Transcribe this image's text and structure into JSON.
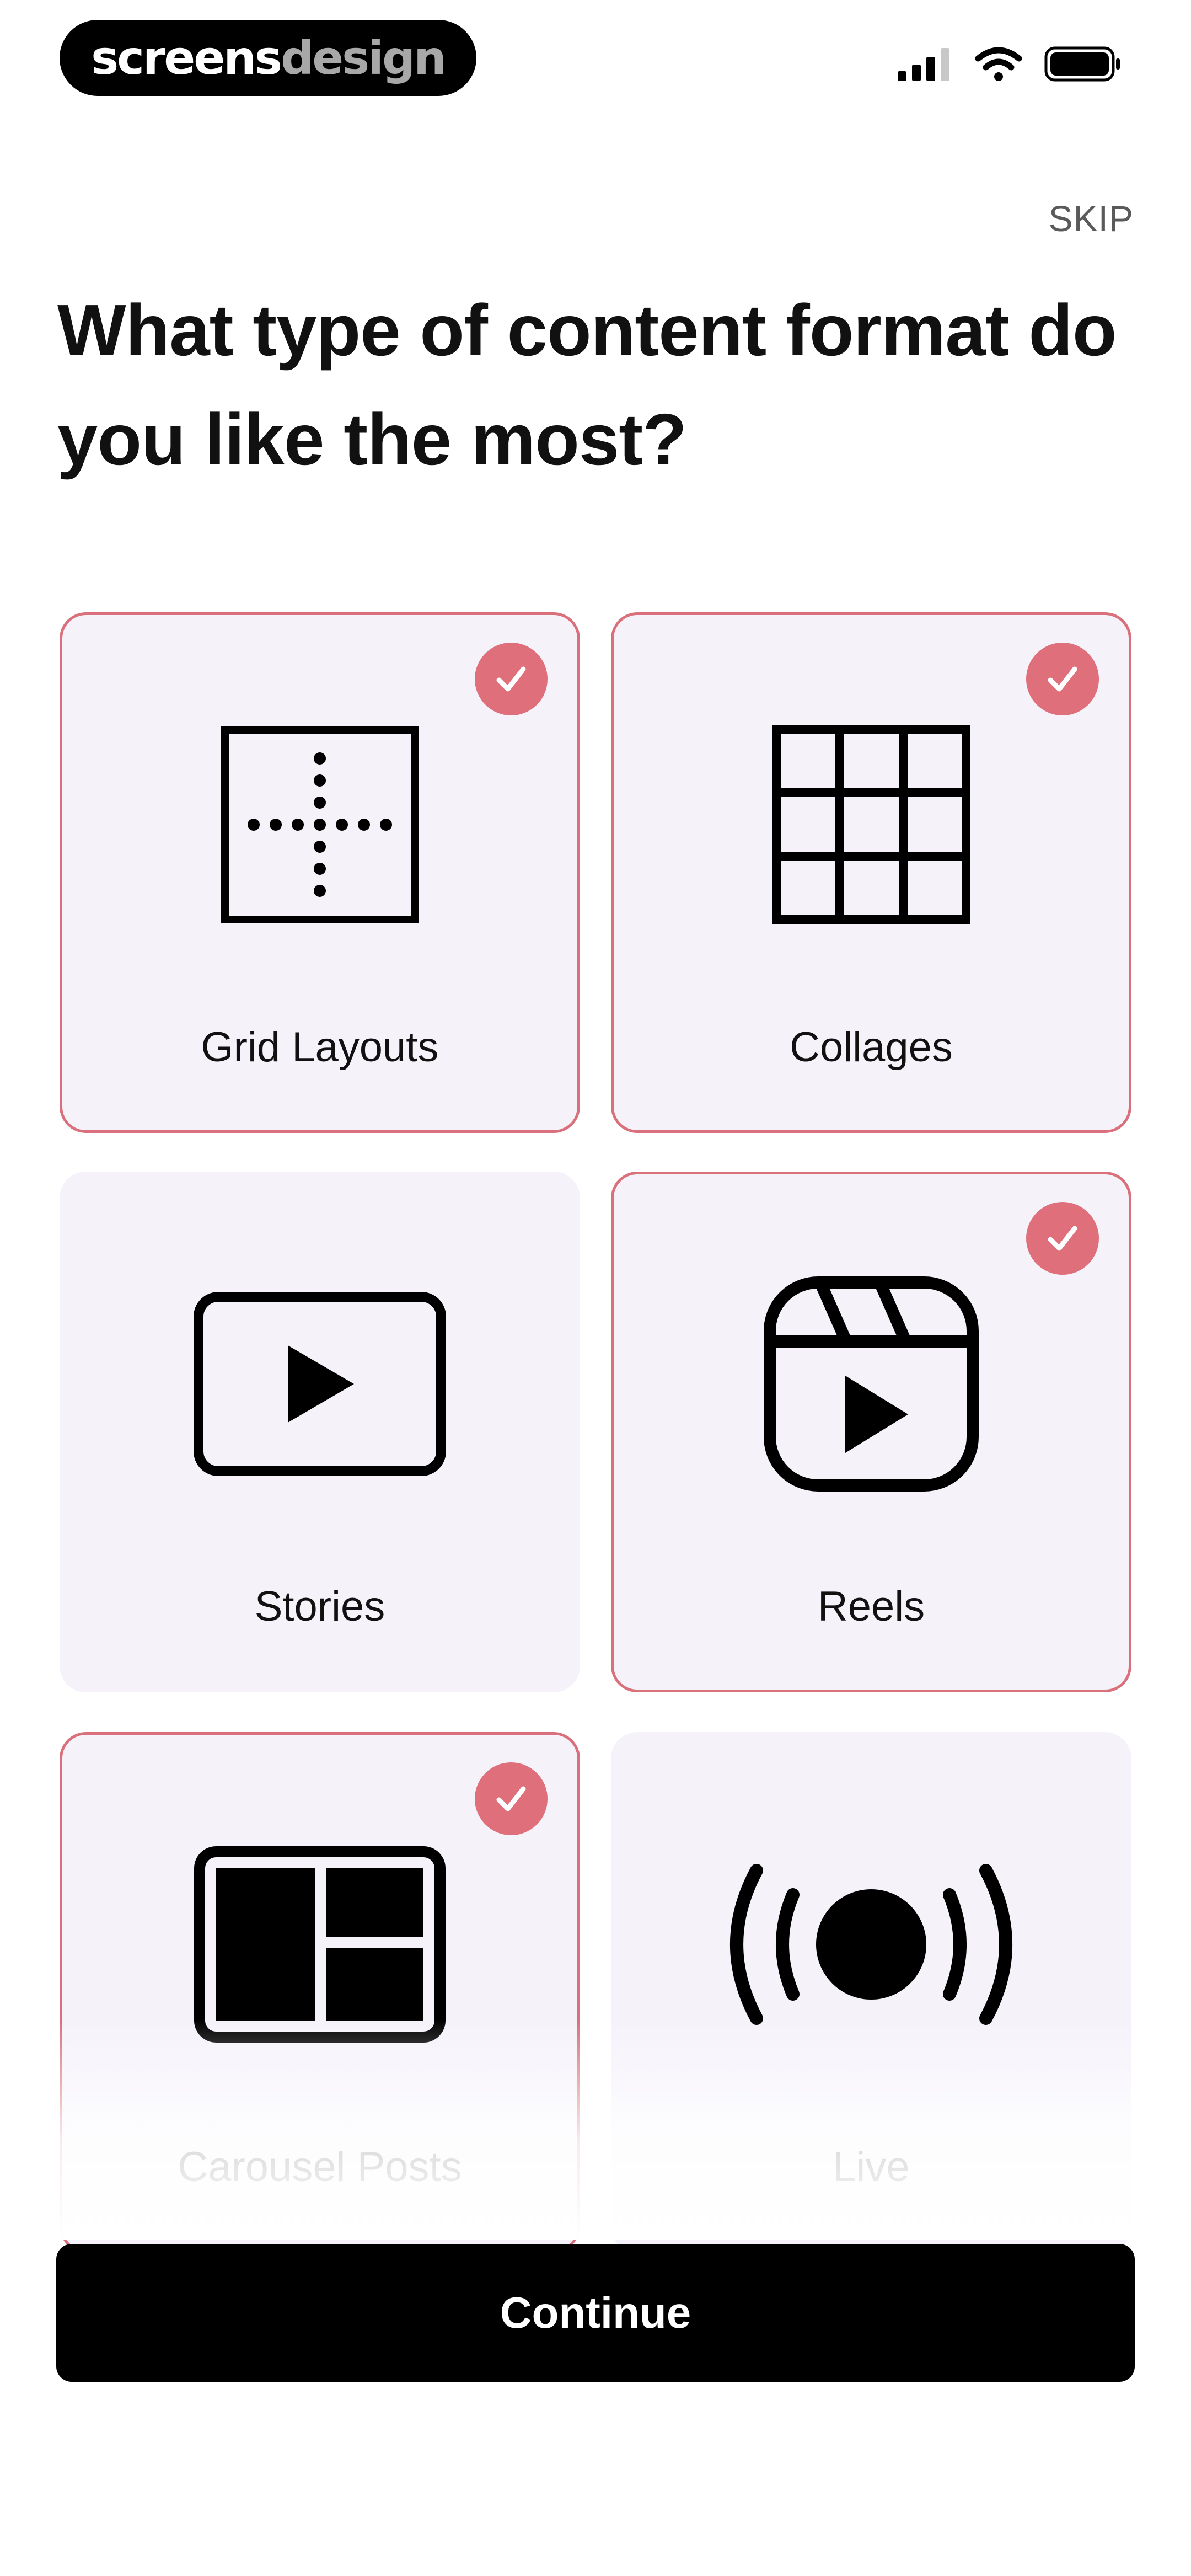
{
  "status_bar": {
    "brand_part1": "screens",
    "brand_part2": "design",
    "icons": [
      "signal-icon",
      "wifi-icon",
      "battery-icon"
    ]
  },
  "header": {
    "skip_label": "SKIP",
    "title": "What type of content format do you like the most?"
  },
  "options": [
    {
      "label": "Grid Layouts",
      "icon": "grid-layout-icon",
      "selected": true
    },
    {
      "label": "Collages",
      "icon": "collage-grid-icon",
      "selected": true
    },
    {
      "label": "Stories",
      "icon": "play-icon",
      "selected": false
    },
    {
      "label": "Reels",
      "icon": "reels-icon",
      "selected": true
    },
    {
      "label": "Carousel Posts",
      "icon": "carousel-icon",
      "selected": true
    },
    {
      "label": "Live",
      "icon": "live-broadcast-icon",
      "selected": false
    }
  ],
  "footer": {
    "continue_label": "Continue"
  },
  "colors": {
    "accent": "#de6f7b",
    "card_background": "#f5f2fa",
    "button_background": "#000000"
  }
}
